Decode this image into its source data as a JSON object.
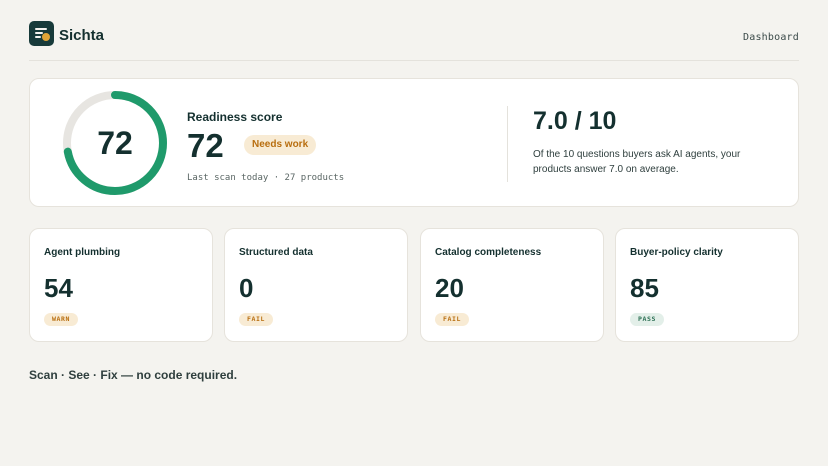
{
  "header": {
    "brand": "Sichta",
    "nav_link": "Dashboard"
  },
  "readiness": {
    "score": 72,
    "score_label": "Readiness score",
    "status_badge": "Needs work",
    "scan_meta": "Last scan today · 27 products",
    "max_score": 100,
    "gauge_color": "#1f9a6b",
    "gauge_track_color": "#e7e5e1"
  },
  "answers": {
    "ratio": "7.0 / 10",
    "description": "Of the 10 questions buyers ask AI agents, your products answer 7.0 on average."
  },
  "cards": [
    {
      "title": "Agent plumbing",
      "value": "54",
      "status": "WARN",
      "status_type": "warn"
    },
    {
      "title": "Structured data",
      "value": "0",
      "status": "FAIL",
      "status_type": "fail"
    },
    {
      "title": "Catalog completeness",
      "value": "20",
      "status": "FAIL",
      "status_type": "fail"
    },
    {
      "title": "Buyer-policy clarity",
      "value": "85",
      "status": "PASS",
      "status_type": "pass"
    }
  ],
  "tagline": "Scan · See · Fix — no code required.",
  "colors": {
    "background": "#f4f3ef",
    "brand_dark": "#173a3a",
    "warn": "#b86e0f",
    "pass": "#2a6e52"
  }
}
